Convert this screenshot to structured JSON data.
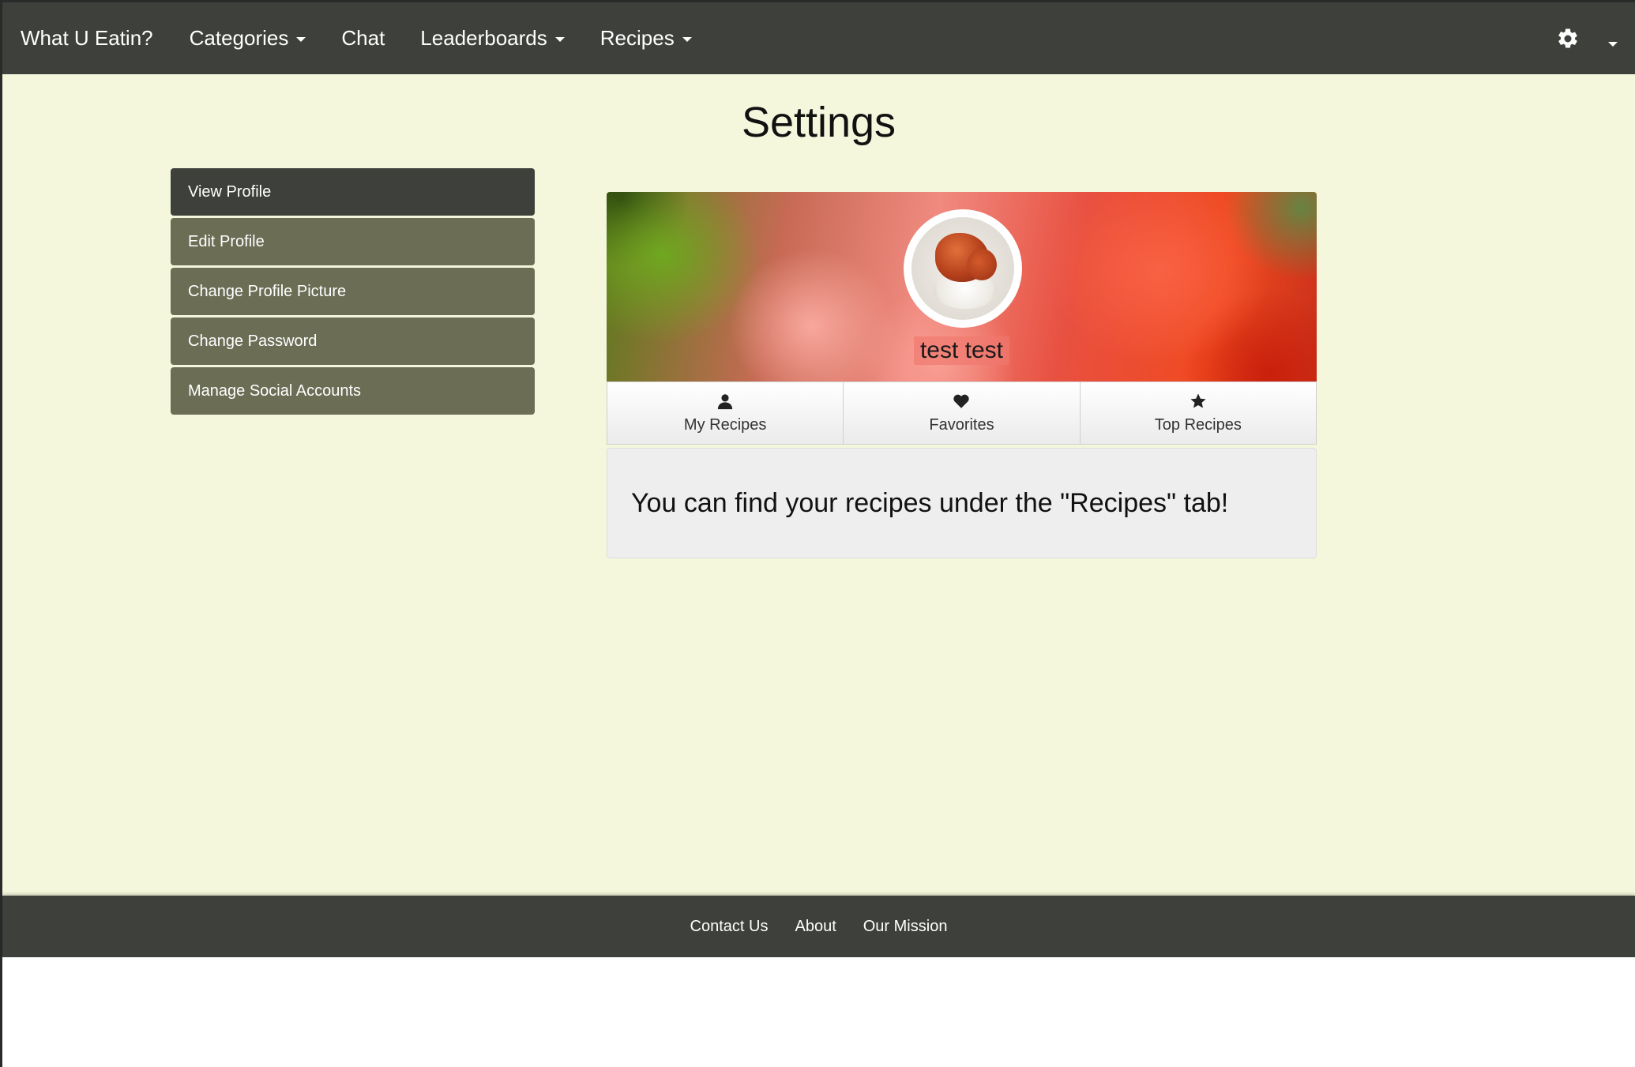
{
  "navbar": {
    "brand": "What U Eatin?",
    "items": [
      {
        "label": "Categories",
        "dropdown": true
      },
      {
        "label": "Chat",
        "dropdown": false
      },
      {
        "label": "Leaderboards",
        "dropdown": true
      },
      {
        "label": "Recipes",
        "dropdown": true
      }
    ],
    "settings_icon": "gear-icon"
  },
  "page": {
    "title": "Settings"
  },
  "sidebar": {
    "items": [
      {
        "label": "View Profile",
        "active": true
      },
      {
        "label": "Edit Profile",
        "active": false
      },
      {
        "label": "Change Profile Picture",
        "active": false
      },
      {
        "label": "Change Password",
        "active": false
      },
      {
        "label": "Manage Social Accounts",
        "active": false
      }
    ]
  },
  "profile": {
    "username": "test test",
    "tabs": [
      {
        "label": "My Recipes",
        "icon": "user-icon"
      },
      {
        "label": "Favorites",
        "icon": "heart-icon"
      },
      {
        "label": "Top Recipes",
        "icon": "star-icon"
      }
    ],
    "message": "You can find your recipes under the \"Recipes\" tab!"
  },
  "footer": {
    "links": [
      "Contact Us",
      "About",
      "Our Mission"
    ]
  },
  "colors": {
    "navbar_bg": "#3e403b",
    "page_bg": "#f4f7dc",
    "sidebar_item_bg": "#6b6e55",
    "sidebar_active_bg": "#3e403b"
  }
}
